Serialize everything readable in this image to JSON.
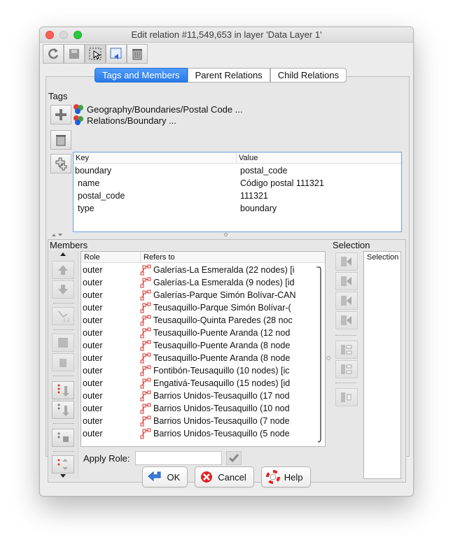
{
  "window": {
    "title": "Edit relation #11,549,653 in layer 'Data Layer 1'"
  },
  "toolbar": {
    "buttons": [
      "refresh-icon",
      "save-icon",
      "select-icon",
      "apply-icon",
      "delete-icon"
    ]
  },
  "tabs": [
    "Tags and Members",
    "Parent Relations",
    "Child Relations"
  ],
  "tags": {
    "section_label": "Tags",
    "presets": [
      "Geography/Boundaries/Postal Code ...",
      "Relations/Boundary ..."
    ],
    "columns": [
      "Key",
      "Value"
    ],
    "rows": [
      {
        "key": "boundary",
        "value": "postal_code"
      },
      {
        "key": "name",
        "value": "Código postal 111321"
      },
      {
        "key": "postal_code",
        "value": "111321"
      },
      {
        "key": "type",
        "value": "boundary"
      }
    ]
  },
  "members": {
    "section_label": "Members",
    "columns": [
      "Role",
      "Refers to"
    ],
    "rows": [
      {
        "role": "outer",
        "ref": "Galerías-La Esmeralda (22 nodes) [i"
      },
      {
        "role": "outer",
        "ref": "Galerías-La Esmeralda (9 nodes) [id"
      },
      {
        "role": "outer",
        "ref": "Galerías-Parque Simón Bolívar-CAN"
      },
      {
        "role": "outer",
        "ref": "Teusaquillo-Parque Simón Bolívar-("
      },
      {
        "role": "outer",
        "ref": "Teusaquillo-Quinta Paredes (28 noc"
      },
      {
        "role": "outer",
        "ref": "Teusaquillo-Puente Aranda (12 nod"
      },
      {
        "role": "outer",
        "ref": "Teusaquillo-Puente Aranda (8 node"
      },
      {
        "role": "outer",
        "ref": "Teusaquillo-Puente Aranda (8 node"
      },
      {
        "role": "outer",
        "ref": "Fontibón-Teusaquillo (10 nodes) [ic"
      },
      {
        "role": "outer",
        "ref": "Engativá-Teusaquillo (15 nodes) [id"
      },
      {
        "role": "outer",
        "ref": "Barrios Unidos-Teusaquillo (17 nod"
      },
      {
        "role": "outer",
        "ref": "Barrios Unidos-Teusaquillo (10 nod"
      },
      {
        "role": "outer",
        "ref": "Barrios Unidos-Teusaquillo (7 node"
      },
      {
        "role": "outer",
        "ref": "Barrios Unidos-Teusaquillo (5 node"
      }
    ],
    "apply_role_label": "Apply Role:",
    "apply_role_value": ""
  },
  "selection": {
    "section_label": "Selection",
    "column": "Selection"
  },
  "buttons": {
    "ok": "OK",
    "cancel": "Cancel",
    "help": "Help"
  }
}
